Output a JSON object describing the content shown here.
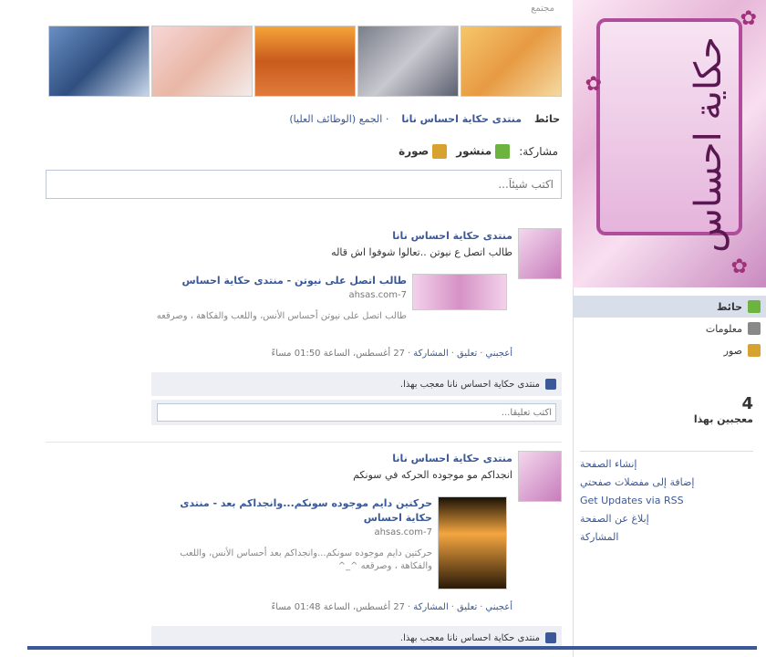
{
  "header": {
    "top_label": "مجتمع"
  },
  "breadcrumb": {
    "wall": "حائط",
    "page_title": "منتدى حكاية احساس نانا",
    "sub": "· الجمع (الوظائف العليا)"
  },
  "composer": {
    "share_label": "مشاركة:",
    "post_label": "منشور",
    "photo_label": "صورة",
    "placeholder": "اكتب شيئاً..."
  },
  "sidebar": {
    "nav": [
      {
        "label": "حائط",
        "icon": "wall-icon"
      },
      {
        "label": "معلومات",
        "icon": "info-icon"
      },
      {
        "label": "صور",
        "icon": "photo-icon"
      }
    ],
    "likes_count": "4",
    "likes_label": "معجبين بهذا",
    "links": [
      "إنشاء الصفحة",
      "إضافة إلى مفضلات صفحتي",
      "Get Updates via RSS",
      "إبلاغ عن الصفحة",
      "المشاركة"
    ]
  },
  "posts": [
    {
      "author": "منتدى حكاية احساس نانا",
      "message": "طالب اتصل ع نيوتن ..تعالوا شوفوا اش قاله",
      "link_title": "طالب اتصل على نيوتن - منتدى حكاية احساس",
      "link_domain": "7-ahsas.com",
      "link_desc": "طالب اتصل على نيوتن أحساس الأنس، واللعب والفكاهة ، وصرقعه",
      "like": "أعجبني",
      "comment": "تعليق",
      "share": "المشاركة",
      "date": "27 أغسطس، الساعة 01:50 مساءً",
      "likes_text": "منتدى حكاية احساس نانا معجب بهذا.",
      "comment_placeholder": "اكتب تعليقاً..."
    },
    {
      "author": "منتدى حكاية احساس نانا",
      "message": "انجداكم مو موجوده الحركه في سونكم",
      "link_title": "حركتين دايم موجوده سونكم...وانجداكم بعد - منتدى حكاية احساس",
      "link_domain": "7-ahsas.com",
      "link_desc": "حركتين دايم موجوده سونكم...وانجداكم بعد أحساس الأنس، واللعب والفكاهة ، وصرقعه ^_^",
      "like": "أعجبني",
      "comment": "تعليق",
      "share": "المشاركة",
      "date": "27 أغسطس، الساعة 01:48 مساءً",
      "likes_text": "منتدى حكاية احساس نانا معجب بهذا."
    }
  ],
  "colors": {
    "link": "#3b5998",
    "accent": "#b04d9a"
  }
}
